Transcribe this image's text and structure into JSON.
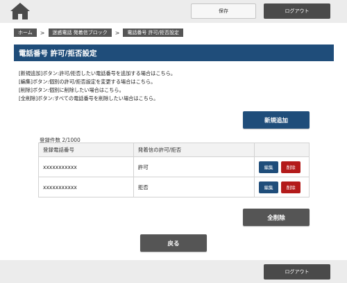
{
  "header": {
    "save_label": "保存",
    "logout_label": "ログアウト"
  },
  "breadcrumb": [
    {
      "label": "ホーム"
    },
    {
      "label": "迷惑電話 発着信ブロック"
    },
    {
      "label": "電話番号 許可/拒否設定"
    }
  ],
  "breadcrumb_sep": ">",
  "page": {
    "title": "電話番号 許可/拒否設定"
  },
  "help": [
    "[新規追加]ボタン:許可/拒否したい電話番号を追加する場合はこちら。",
    "[編集]ボタン:個別の許可/拒否設定を変更する場合はこちら。",
    "[削除]ボタン:個別に削除したい場合はこちら。",
    "[全削除]ボタン:すべての電話番号を削除したい場合はこちら。"
  ],
  "actions": {
    "add_label": "新規追加",
    "delete_all_label": "全削除",
    "back_label": "戻る"
  },
  "table": {
    "count_text": "登録件数 2/1000",
    "headers": [
      "登録電話番号",
      "発着信の許可/拒否",
      ""
    ],
    "rows": [
      {
        "number": "xxxxxxxxxxx",
        "status": "許可",
        "edit_label": "編集",
        "delete_label": "削除"
      },
      {
        "number": "xxxxxxxxxxx",
        "status": "拒否",
        "edit_label": "編集",
        "delete_label": "削除"
      }
    ]
  },
  "footer": {
    "logout_label": "ログアウト"
  },
  "colors": {
    "primary": "#1f4d7a",
    "danger": "#b31b1b",
    "dark_button": "#555555",
    "bar_background": "#ececec"
  },
  "icons": {
    "home": "home-icon"
  }
}
